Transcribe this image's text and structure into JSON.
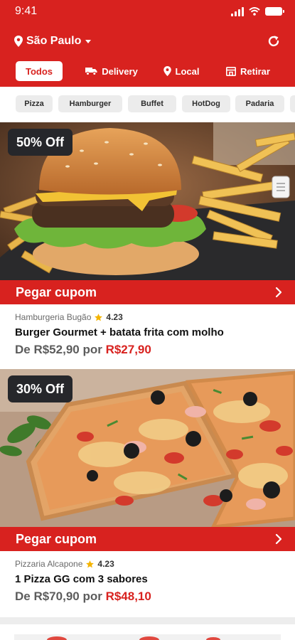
{
  "statusbar": {
    "time": "9:41"
  },
  "header": {
    "city": "São Paulo"
  },
  "tabs": [
    {
      "label": "Todos",
      "icon": "none",
      "active": true
    },
    {
      "label": "Delivery",
      "icon": "truck-icon",
      "active": false
    },
    {
      "label": "Local",
      "icon": "map-pin-icon",
      "active": false
    },
    {
      "label": "Retirar",
      "icon": "store-icon",
      "active": false
    }
  ],
  "categories": [
    "Pizza",
    "Hamburger",
    "Buffet",
    "HotDog",
    "Padaria"
  ],
  "offers": [
    {
      "discount": "50% Off",
      "coupon_label": "Pegar cupom",
      "restaurant": "Hamburgeria Bugão",
      "rating": "4.23",
      "title": "Burger Gourmet + batata frita com molho",
      "price_prefix": "De R$52,90 por ",
      "price_new": "R$27,90"
    },
    {
      "discount": "30% Off",
      "coupon_label": "Pegar cupom",
      "restaurant": "Pizzaria Alcapone",
      "rating": "4.23",
      "title": "1 Pizza GG com 3 sabores",
      "price_prefix": "De R$70,90 por ",
      "price_new": "R$48,10"
    }
  ],
  "colors": {
    "brand_red": "#d8221f",
    "badge_dark": "#26272b",
    "star": "#f4b400"
  }
}
